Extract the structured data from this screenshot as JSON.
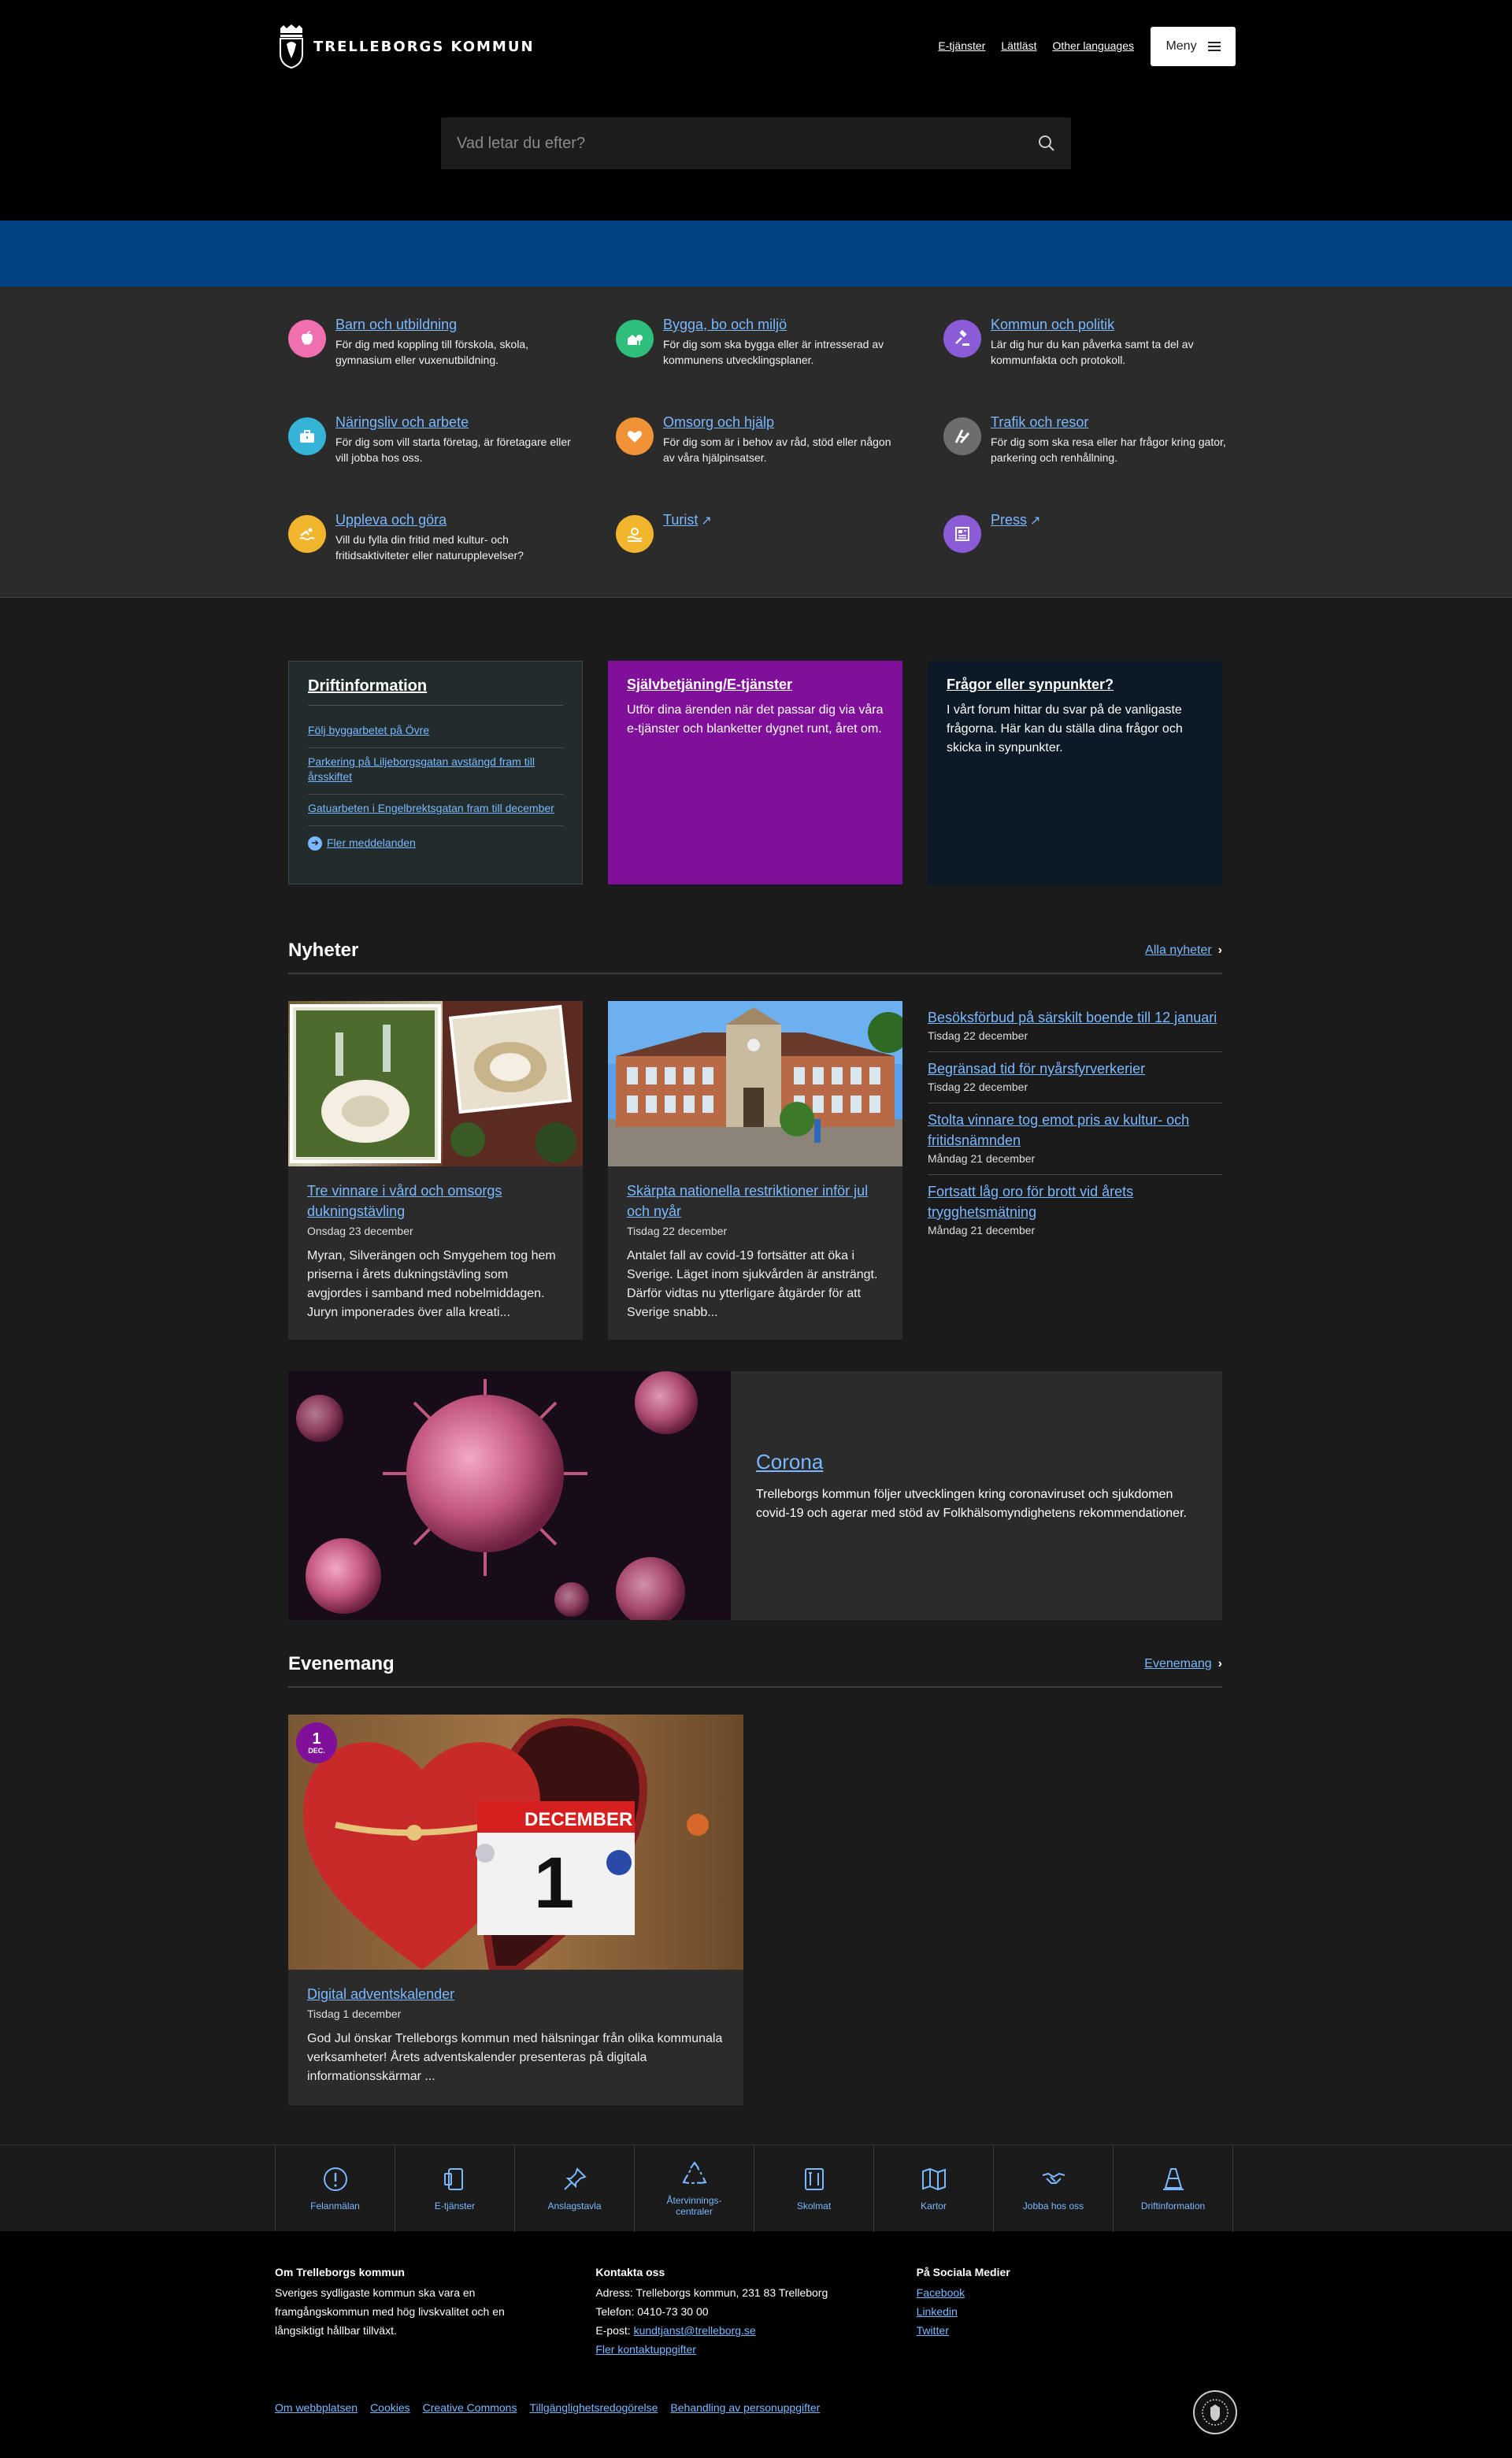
{
  "header": {
    "logo_text": "TRELLEBORGS KOMMUN",
    "links": [
      "E-tjänster",
      "Lättläst",
      "Other languages"
    ],
    "menu_label": "Meny",
    "search_placeholder": "Vad letar du efter?"
  },
  "categories": [
    {
      "title": "Barn och utbildning",
      "desc": "För dig med koppling till förskola, skola, gymnasium eller vuxenutbildning.",
      "icon": "apple-icon",
      "color": "#f06fae"
    },
    {
      "title": "Bygga, bo och miljö",
      "desc": "För dig som ska bygga eller är intresserad av kommunens utvecklingsplaner.",
      "icon": "house-tree-icon",
      "color": "#2fbf7c"
    },
    {
      "title": "Kommun och politik",
      "desc": "Lär dig hur du kan påverka samt ta del av kommunfakta och protokoll.",
      "icon": "gavel-icon",
      "color": "#8a5cd8"
    },
    {
      "title": "Näringsliv och arbete",
      "desc": "För dig som vill starta företag, är företagare eller vill jobba hos oss.",
      "icon": "briefcase-icon",
      "color": "#35b4d8"
    },
    {
      "title": "Omsorg och hjälp",
      "desc": "För dig som är i behov av råd, stöd eller någon av våra hjälpinsatser.",
      "icon": "heart-icon",
      "color": "#f29236"
    },
    {
      "title": "Trafik och resor",
      "desc": "För dig som ska resa eller har frågor kring gator, parkering och renhållning.",
      "icon": "road-icon",
      "color": "#6d6d6d"
    },
    {
      "title": "Uppleva och göra",
      "desc": "Vill du fylla din fritid med kultur- och fritidsaktiviteter eller naturupplevelser?",
      "icon": "swimmer-icon",
      "color": "#f2b52e"
    },
    {
      "title": "Turist",
      "desc": "",
      "icon": "beach-icon",
      "color": "#f2b52e"
    },
    {
      "title": "Press",
      "desc": "",
      "icon": "newspaper-icon",
      "color": "#8a5cd8"
    }
  ],
  "drift": {
    "title": "Driftinformation",
    "items": [
      "Följ byggarbetet på Övre",
      "Parkering på Liljeborgsgatan avstängd fram till årsskiftet",
      "Gatuarbeten i Engelbrektsgatan fram till december"
    ],
    "more": "Fler meddelanden"
  },
  "selfservice": {
    "title": "Självbetjäning/E-tjänster",
    "text": "Utför dina ärenden när det passar dig via våra e-tjänster och blanketter dygnet runt, året om."
  },
  "feedback": {
    "title": "Frågor eller synpunkter?",
    "text": "I vårt forum hittar du svar på de vanligaste frågorna. Här kan du ställa dina frågor och skicka in synpunkter."
  },
  "news": {
    "heading": "Nyheter",
    "all_link": "Alla nyheter",
    "cards": [
      {
        "title": "Tre vinnare i vård och omsorgs dukningstävling",
        "date": "Onsdag 23 december",
        "text": "Myran, Silverängen och Smygehem tog hem priserna i årets dukningstävling som avgjordes i samband med nobelmiddagen. Juryn imponerades över alla kreati..."
      },
      {
        "title": "Skärpta nationella restriktioner inför jul och nyår",
        "date": "Tisdag 22 december",
        "text": "Antalet fall av covid-19 fortsätter att öka i Sverige. Läget inom sjukvården är ansträngt. Därför vidtas nu ytterligare åtgärder för att Sverige snabb..."
      }
    ],
    "list": [
      {
        "title": "Besöksförbud på särskilt boende till 12 januari",
        "date": "Tisdag 22 december"
      },
      {
        "title": "Begränsad tid för nyårsfyrverkerier",
        "date": "Tisdag 22 december"
      },
      {
        "title": "Stolta vinnare tog emot pris av kultur- och fritidsnämnden",
        "date": "Måndag 21 december"
      },
      {
        "title": "Fortsatt låg oro för brott vid årets trygghetsmätning",
        "date": "Måndag 21 december"
      }
    ]
  },
  "corona": {
    "title": "Corona",
    "text": "Trelleborgs kommun följer utvecklingen kring coronaviruset och sjukdomen covid-19 och agerar med stöd av Folkhälsomyndighetens rekommendationer."
  },
  "events": {
    "heading": "Evenemang",
    "all_link": "Evenemang",
    "card": {
      "badge_day": "1",
      "badge_month": "DEC.",
      "calendar_text": "DECEMBER",
      "calendar_day": "1",
      "title": "Digital adventskalender",
      "date": "Tisdag 1 december",
      "text": "God Jul önskar Trelleborgs kommun med hälsningar från olika kommunala verksamheter! Årets adventskalender presenteras på digitala informationsskärmar ..."
    }
  },
  "quicklinks": [
    {
      "label": "Felanmälan",
      "icon": "exclamation-icon"
    },
    {
      "label": "E-tjänster",
      "icon": "tablet-icon"
    },
    {
      "label": "Anslagstavla",
      "icon": "pin-icon"
    },
    {
      "label": "Återvinnings-\ncentraler",
      "icon": "recycle-icon"
    },
    {
      "label": "Skolmat",
      "icon": "menu-card-icon"
    },
    {
      "label": "Kartor",
      "icon": "map-icon"
    },
    {
      "label": "Jobba hos oss",
      "icon": "handshake-icon"
    },
    {
      "label": "Driftinformation",
      "icon": "cone-icon"
    }
  ],
  "footer": {
    "about_title": "Om Trelleborgs kommun",
    "about_text": "Sveriges sydligaste kommun ska vara en framgångskommun med hög livskvalitet och en långsiktigt hållbar tillväxt.",
    "contact_title": "Kontakta oss",
    "address": "Adress: Trelleborgs kommun, 231 83 Trelleborg",
    "phone": "Telefon: 0410-73 30 00",
    "email_label": "E-post: ",
    "email": "kundtjanst@trelleborg.se",
    "more_contact": "Fler kontaktuppgifter",
    "social_title": "På Sociala Medier",
    "social": [
      "Facebook",
      "Linkedin",
      "Twitter"
    ],
    "bottom_links": [
      "Om webbplatsen",
      "Cookies",
      "Creative Commons",
      "Tillgänglighetsredogörelse",
      "Behandling av personuppgifter"
    ]
  },
  "colors": {
    "link": "#7ab8ff",
    "brand_blue": "#004282",
    "purple": "#80109a"
  }
}
